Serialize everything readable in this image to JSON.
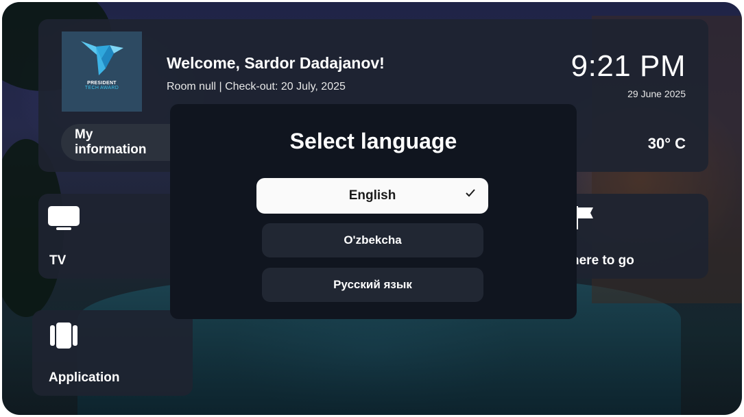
{
  "header": {
    "logo_line1": "PRESIDENT",
    "logo_line2": "TECH AWARD",
    "welcome": "Welcome, Sardor Dadajanov!",
    "room_info": "Room null | Check-out: 20 July, 2025",
    "time": "9:21 PM",
    "date": "29 June 2025",
    "temperature": "30° C",
    "my_info_label": "My information"
  },
  "tiles": {
    "tv_label": "TV",
    "app_label": "Application",
    "where_label": "here to go"
  },
  "language_modal": {
    "title": "Select language",
    "options": [
      {
        "label": "English",
        "selected": true
      },
      {
        "label": "O'zbekcha",
        "selected": false
      },
      {
        "label": "Русский язык",
        "selected": false
      }
    ]
  },
  "colors": {
    "card_bg": "#1e2430",
    "modal_bg": "#10151f",
    "selected_option": "#fafafa",
    "accent_logo": "#39c0ea"
  },
  "icons": [
    "tv-icon",
    "application-icon",
    "flag-icon",
    "checkmark-icon",
    "bird-logo-icon"
  ]
}
